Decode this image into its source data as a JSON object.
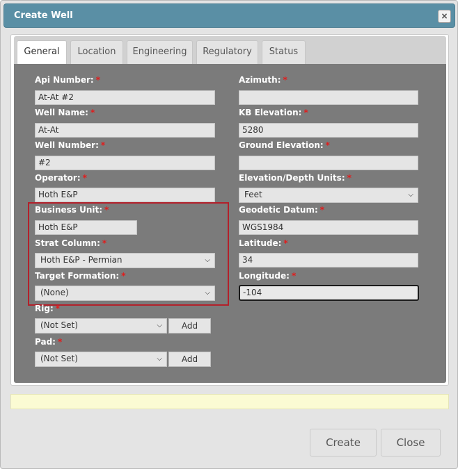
{
  "dialog": {
    "title": "Create Well",
    "close_glyph": "×"
  },
  "tabs": [
    {
      "label": "General",
      "active": true
    },
    {
      "label": "Location"
    },
    {
      "label": "Engineering"
    },
    {
      "label": "Regulatory"
    },
    {
      "label": "Status"
    }
  ],
  "required_marker": "*",
  "fields": {
    "api_number": {
      "label": "Api Number:",
      "value": "At-At #2"
    },
    "well_name": {
      "label": "Well Name:",
      "value": "At-At"
    },
    "well_number": {
      "label": "Well Number:",
      "value": "#2"
    },
    "operator": {
      "label": "Operator:",
      "value": "Hoth E&P"
    },
    "business_unit": {
      "label": "Business Unit:",
      "value": "Hoth E&P"
    },
    "strat_column": {
      "label": "Strat Column:",
      "value": "Hoth E&P - Permian"
    },
    "target_formation": {
      "label": "Target Formation:",
      "value": "(None)"
    },
    "rig": {
      "label": "Rig:",
      "value": "(Not Set)",
      "add_label": "Add"
    },
    "pad": {
      "label": "Pad:",
      "value": "(Not Set)",
      "add_label": "Add"
    },
    "azimuth": {
      "label": "Azimuth:",
      "value": ""
    },
    "kb_elevation": {
      "label": "KB Elevation:",
      "value": "5280"
    },
    "ground_elevation": {
      "label": "Ground Elevation:",
      "value": ""
    },
    "elevation_units": {
      "label": "Elevation/Depth Units:",
      "value": "Feet"
    },
    "geodetic_datum": {
      "label": "Geodetic Datum:",
      "value": "WGS1984"
    },
    "latitude": {
      "label": "Latitude:",
      "value": "34"
    },
    "longitude": {
      "label": "Longitude:",
      "value": "-104"
    }
  },
  "icons": {
    "dropdown": "chevron-down-icon",
    "close": "close-icon"
  },
  "colors": {
    "titlebar": "#5a8fa5",
    "required": "#e31b1b",
    "highlight": "#b3202a",
    "notice": "#fbfbd3"
  },
  "footer": {
    "create_label": "Create",
    "close_label": "Close"
  }
}
